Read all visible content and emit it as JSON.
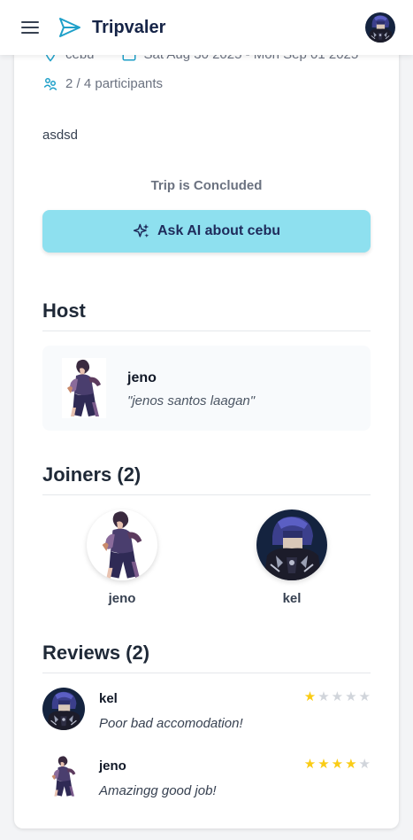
{
  "header": {
    "brand": "Tripvaler",
    "menu_icon": "hamburger-menu-icon",
    "logo_icon": "paper-plane-icon",
    "accent": "#1fa0c9"
  },
  "trip": {
    "location": "cebu",
    "dates": "Sat Aug 30 2025 - Mon Sep 01 2025",
    "participants": "2 / 4 participants",
    "description": "asdsd",
    "status": "Trip is Concluded",
    "ask_button": "Ask AI about cebu",
    "ask_icon": "sparkles-icon",
    "ask_color": "#8ee0ef"
  },
  "host": {
    "title": "Host",
    "name": "jeno",
    "quote": "\"jenos santos laagan\""
  },
  "joiners": {
    "title": "Joiners (2)",
    "items": [
      {
        "name": "jeno"
      },
      {
        "name": "kel"
      }
    ]
  },
  "reviews": {
    "title": "Reviews (2)",
    "star_color": "#facc15",
    "items": [
      {
        "name": "kel",
        "text": "Poor bad accomodation!",
        "rating": 1,
        "max": 5
      },
      {
        "name": "jeno",
        "text": "Amazingg good job!",
        "rating": 4,
        "max": 5
      }
    ]
  }
}
